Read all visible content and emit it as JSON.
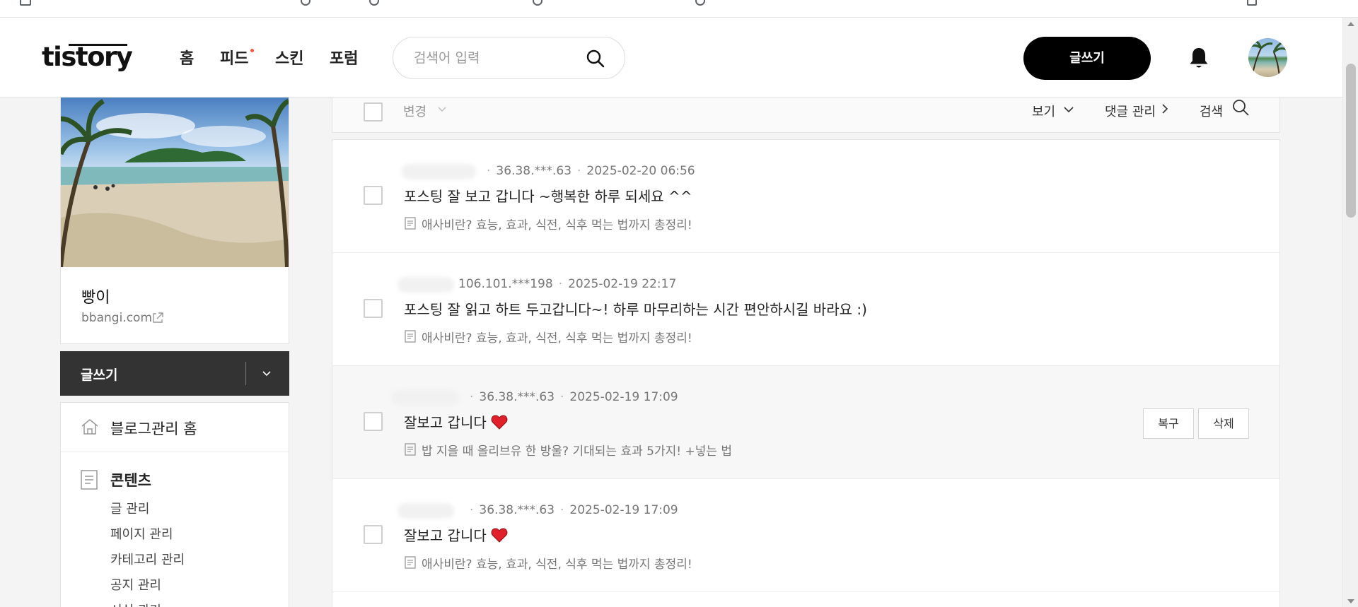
{
  "header": {
    "logo": "tistory",
    "nav": [
      "홈",
      "피드",
      "스킨",
      "포럼"
    ],
    "search_placeholder": "검색어 입력",
    "write_button": "글쓰기"
  },
  "sidebar": {
    "blog_name": "빵이",
    "blog_url": "bbangi.com",
    "write_button": "글쓰기",
    "menu": {
      "home": "블로그관리 홈",
      "contents": "콘텐츠",
      "items": [
        "글 관리",
        "페이지 관리",
        "카테고리 관리",
        "공지 관리",
        "서식 관리"
      ]
    }
  },
  "toolbar": {
    "change": "변경",
    "view": "보기",
    "manage_comments": "댓글 관리",
    "search": "검색"
  },
  "comments": [
    {
      "ip": "36.38.***.63",
      "date": "2025-02-20 06:56",
      "text": "포스팅 잘 보고 갑니다 ~행복한 하루 되세요 ^^",
      "heart": false,
      "post": "애사비란? 효능, 효과, 식전, 식후 먹는 법까지 총정리!"
    },
    {
      "ip": "106.101.***198",
      "date": "2025-02-19 22:17",
      "text": "포스팅 잘 읽고 하트 두고갑니다~! 하루 마무리하는 시간 편안하시길 바라요 :)",
      "heart": false,
      "post": "애사비란? 효능, 효과, 식전, 식후 먹는 법까지 총정리!"
    },
    {
      "ip": "36.38.***.63",
      "date": "2025-02-19 17:09",
      "text": "잘보고 갑니다",
      "heart": true,
      "post": "밥 지을 때 올리브유 한 방울? 기대되는 효과 5가지! +넣는 법",
      "restore_button": "복구",
      "delete_button": "삭제"
    },
    {
      "ip": "36.38.***.63",
      "date": "2025-02-19 17:09",
      "text": "잘보고 갑니다",
      "heart": true,
      "post": "애사비란? 효능, 효과, 식전, 식후 먹는 법까지 총정리!"
    }
  ],
  "colors": {
    "accent": "#000000",
    "feed_dot": "#ff5544",
    "heart": "#e0202a",
    "sidebar_write_bg": "#333333"
  }
}
